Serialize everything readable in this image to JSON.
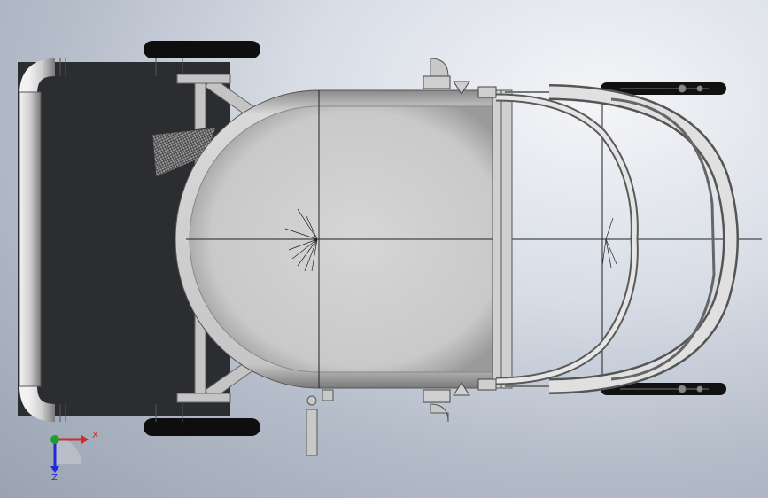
{
  "viewport": {
    "background_top": "#f4f5f8",
    "background_bottom": "#9aa3b1"
  },
  "triad": {
    "x_label": "X",
    "z_label": "Z",
    "x_color": "#d22b2b",
    "z_color": "#1f2bd6",
    "y_color": "#1f9e2b"
  },
  "model": {
    "icons": [
      "frame-tube",
      "wheel",
      "tank",
      "arc-guard",
      "mesh-panel",
      "nozzle"
    ]
  }
}
